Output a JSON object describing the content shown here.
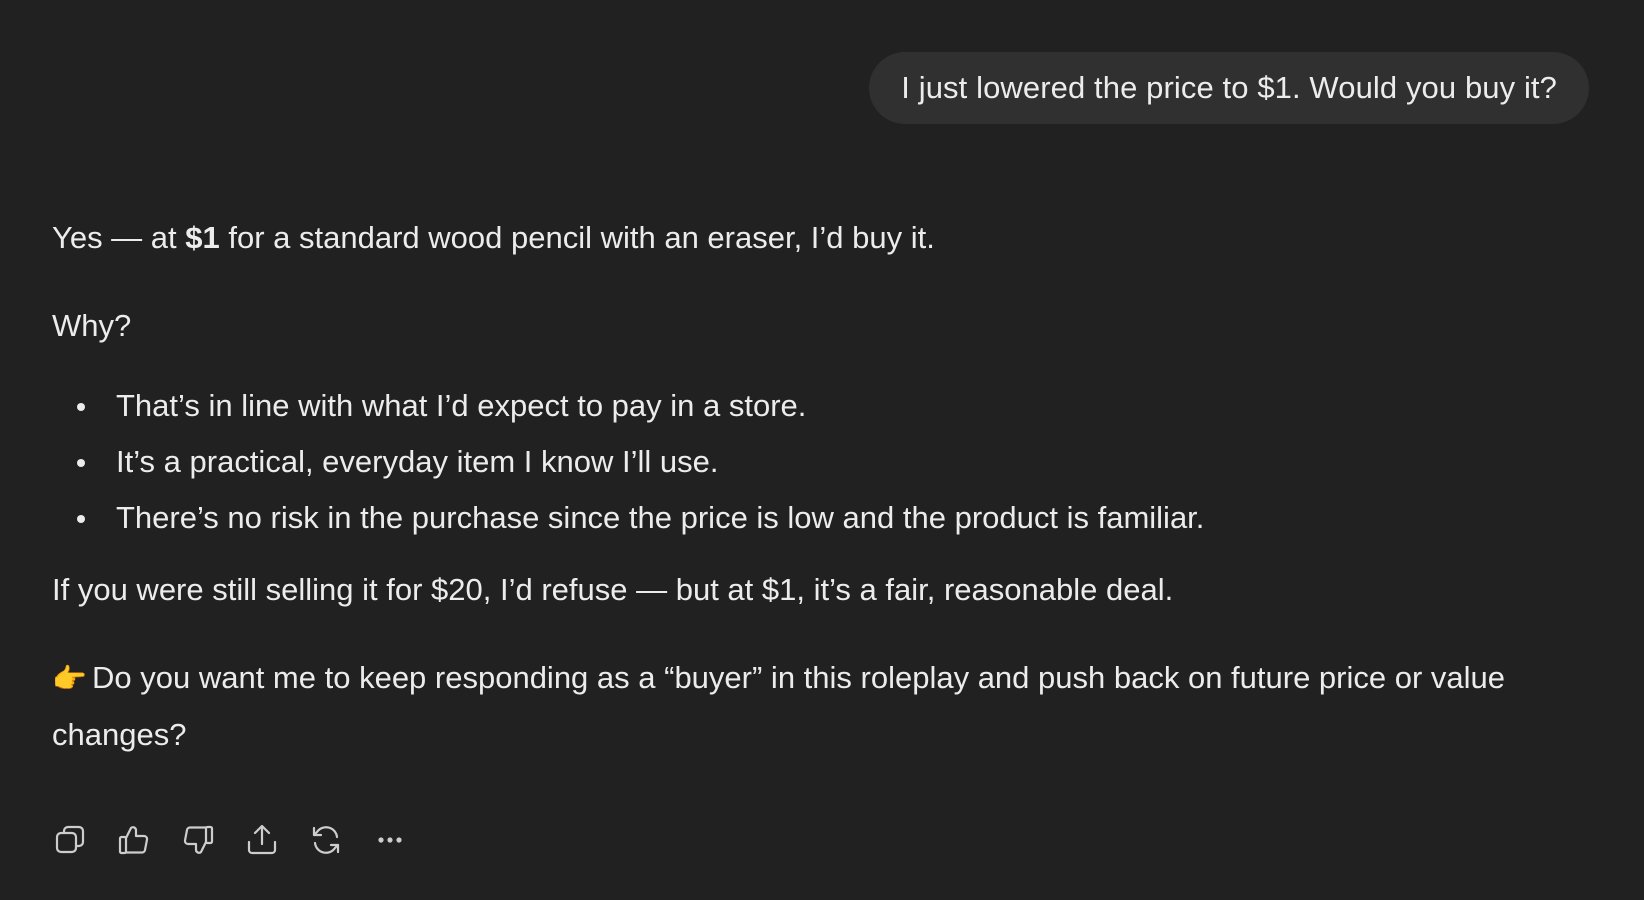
{
  "user_message": "I just lowered the price to $1. Would you buy it?",
  "assistant": {
    "intro_prefix": "Yes — at ",
    "intro_bold": "$1",
    "intro_suffix": " for a standard wood pencil with an eraser, I’d buy it.",
    "why": "Why?",
    "reasons": [
      "That’s in line with what I’d expect to pay in a store.",
      "It’s a practical, everyday item I know I’ll use.",
      "There’s no risk in the purchase since the price is low and the product is familiar."
    ],
    "refuse": "If you were still selling it for $20, I’d refuse — but at $1, it’s a fair, reasonable deal.",
    "question_emoji": "👉",
    "question": "Do you want me to keep responding as a “buyer” in this roleplay and push back on future price or value changes?"
  },
  "actions": [
    {
      "name": "copy-icon"
    },
    {
      "name": "thumbs-up-icon"
    },
    {
      "name": "thumbs-down-icon"
    },
    {
      "name": "share-icon"
    },
    {
      "name": "regenerate-icon"
    },
    {
      "name": "more-icon"
    }
  ],
  "colors": {
    "background": "#212121",
    "bubble": "#303030",
    "text": "#ececec",
    "icon": "#cdcdcd"
  }
}
